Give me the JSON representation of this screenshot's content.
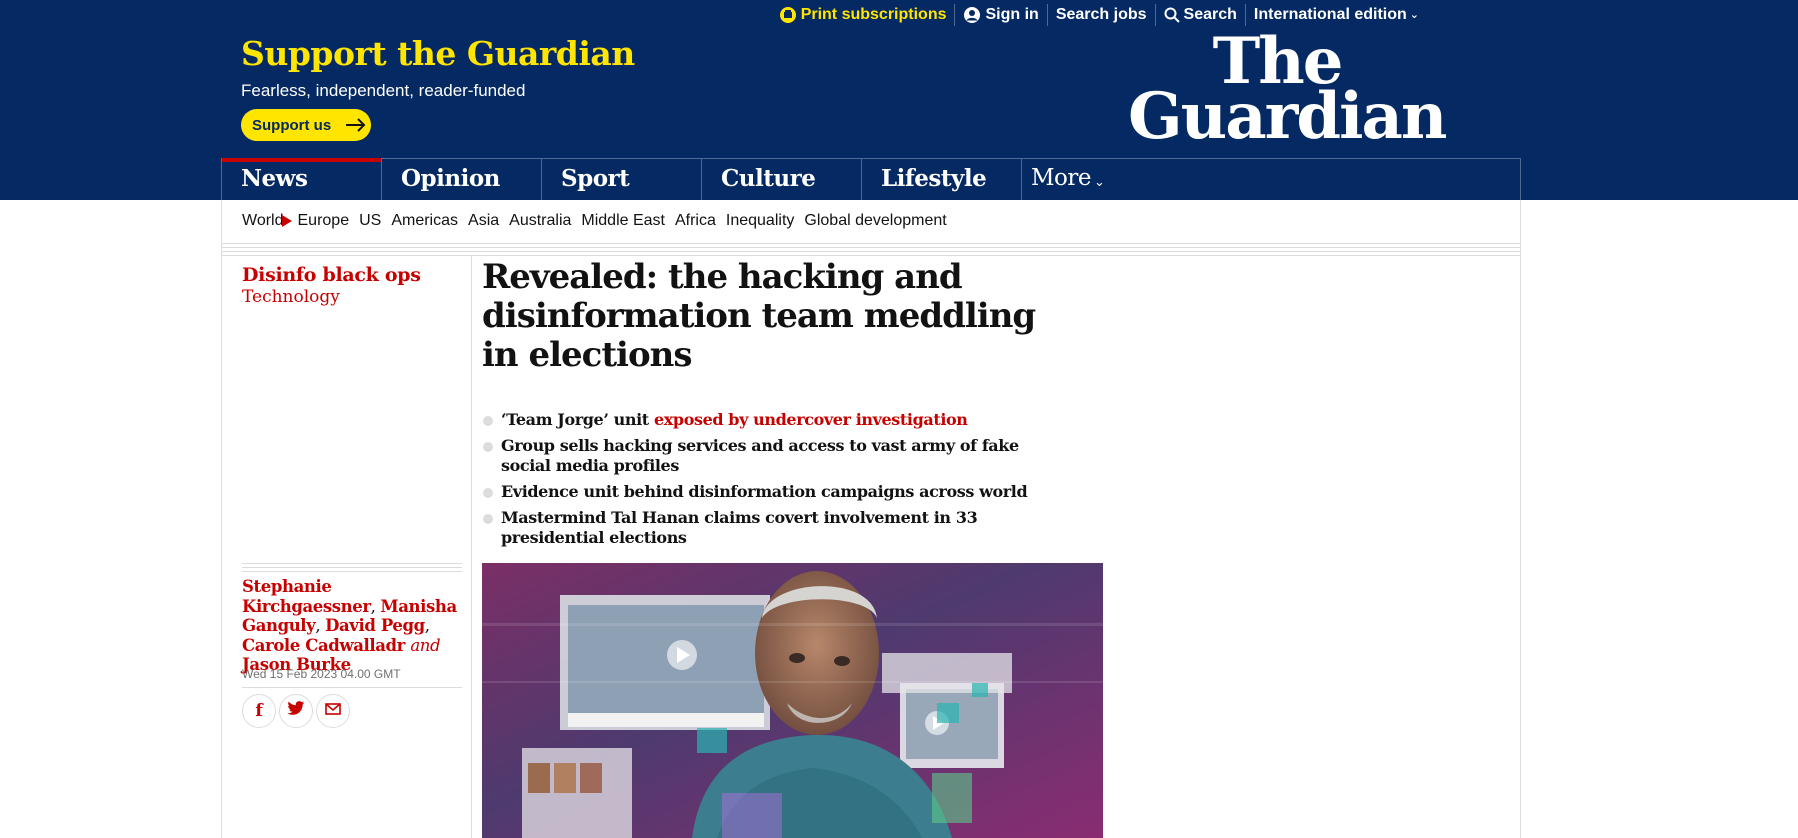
{
  "topbar": {
    "print_subscriptions": "Print subscriptions",
    "sign_in": "Sign in",
    "search_jobs": "Search jobs",
    "search": "Search",
    "edition": "International edition"
  },
  "masthead": {
    "support_title": "Support the Guardian",
    "support_subtitle": "Fearless, independent, reader-funded",
    "support_button": "Support us",
    "logo_line1": "The",
    "logo_line2": "Guardian"
  },
  "pillars": [
    {
      "label": "News",
      "active": true
    },
    {
      "label": "Opinion",
      "active": false
    },
    {
      "label": "Sport",
      "active": false
    },
    {
      "label": "Culture",
      "active": false
    },
    {
      "label": "Lifestyle",
      "active": false
    }
  ],
  "more_label": "More",
  "subnav": {
    "world": "World",
    "items": [
      "Europe",
      "US",
      "Americas",
      "Asia",
      "Australia",
      "Middle East",
      "Africa",
      "Inequality",
      "Global development"
    ]
  },
  "article": {
    "series": "Disinfo black ops",
    "section": "Technology",
    "headline": "Revealed: the hacking and disinformation team meddling in elections",
    "standfirst": {
      "item1_prefix": "‘Team Jorge’ unit ",
      "item1_link": "exposed by undercover investigation",
      "item2": "Group sells hacking services and access to vast army of fake social media profiles",
      "item3": "Evidence unit behind disinformation campaigns across world",
      "item4": "Mastermind Tal Hanan claims covert involvement in 33 presidential elections"
    },
    "authors": {
      "a1": "Stephanie Kirchgaessner",
      "a2": "Manisha Ganguly",
      "a3": "David Pegg",
      "a4": "Carole Cadwalladr",
      "and": "and",
      "a5": "Jason Burke"
    },
    "dateline": "Wed 15 Feb 2023 04.00 GMT"
  },
  "share": [
    "facebook-icon",
    "twitter-icon",
    "email-icon"
  ],
  "colors": {
    "brand_blue": "#052962",
    "support_yellow": "#ffe500",
    "news_red": "#c70000"
  }
}
